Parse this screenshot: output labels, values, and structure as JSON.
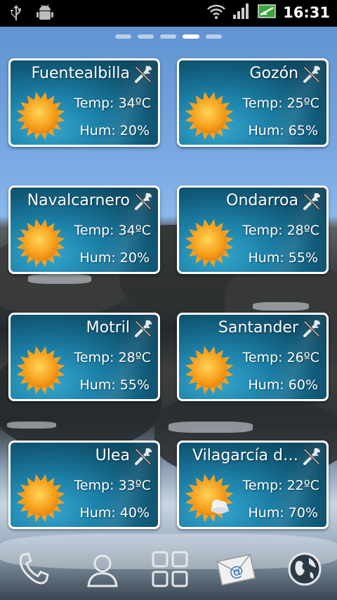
{
  "status_bar": {
    "time": "16:31",
    "icons": [
      "usb-icon",
      "android-debug-icon",
      "wifi-icon",
      "signal-icon",
      "battery-charging-icon"
    ]
  },
  "home": {
    "pages": 5,
    "active_page": 4
  },
  "widgets": [
    {
      "city": "Fuentealbilla",
      "temp": "Temp: 34ºC",
      "hum": "Hum: 20%",
      "condition": "sunny"
    },
    {
      "city": "Gozón",
      "temp": "Temp: 25ºC",
      "hum": "Hum: 65%",
      "condition": "sunny"
    },
    {
      "city": "Navalcarnero",
      "temp": "Temp: 34ºC",
      "hum": "Hum: 20%",
      "condition": "sunny"
    },
    {
      "city": "Ondarroa",
      "temp": "Temp: 28ºC",
      "hum": "Hum: 55%",
      "condition": "sunny"
    },
    {
      "city": "Motril",
      "temp": "Temp: 28ºC",
      "hum": "Hum: 55%",
      "condition": "sunny"
    },
    {
      "city": "Santander",
      "temp": "Temp: 26ºC",
      "hum": "Hum: 60%",
      "condition": "sunny"
    },
    {
      "city": "Ulea",
      "temp": "Temp: 33ºC",
      "hum": "Hum: 40%",
      "condition": "sunny"
    },
    {
      "city": "Vilagarcía d…",
      "temp": "Temp: 22ºC",
      "hum": "Hum: 70%",
      "condition": "partly-cloudy"
    }
  ],
  "dock": [
    "phone-icon",
    "contacts-icon",
    "app-drawer-icon",
    "email-icon",
    "browser-icon"
  ]
}
